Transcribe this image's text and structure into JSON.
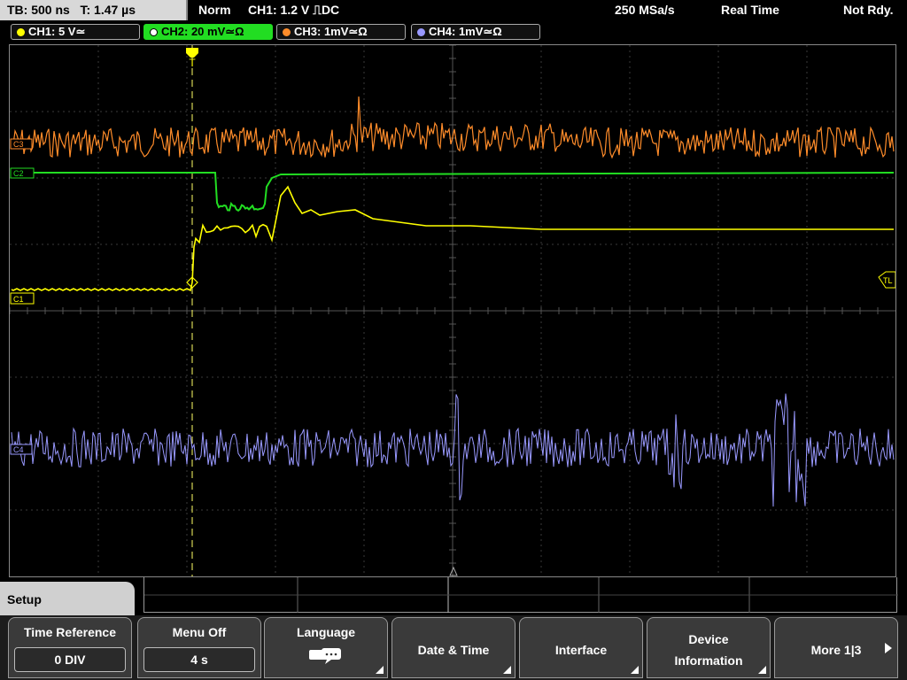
{
  "status": {
    "tb": "TB: 500 ns",
    "t": "T: 1.47 µs",
    "mode": "Norm",
    "trigger": "CH1: 1.2 V ⎍DC",
    "rate": "250 MSa/s",
    "acq": "Real Time",
    "state": "Not Rdy."
  },
  "channels": [
    {
      "label": "CH1: 5 V≃",
      "color": "#ffff00"
    },
    {
      "label": "CH2: 20 mV≃Ω",
      "color": "#22dd22"
    },
    {
      "label": "CH3: 1mV≃Ω",
      "color": "#ff8c2a"
    },
    {
      "label": "CH4: 1mV≃Ω",
      "color": "#9999ff"
    }
  ],
  "markers": {
    "c1": "C1",
    "c2": "C2",
    "c3": "C3",
    "c4": "C4",
    "tl": "TL",
    "trig": "T"
  },
  "menu": {
    "title": "Setup",
    "softkeys": {
      "time_ref_label": "Time Reference",
      "time_ref_value": "0 DIV",
      "menu_off_label": "Menu Off",
      "menu_off_value": "4 s",
      "language_label": "Language",
      "date_time_label": "Date & Time",
      "interface_label": "Interface",
      "device_info_label1": "Device",
      "device_info_label2": "Information",
      "more_label": "More 1|3"
    }
  }
}
